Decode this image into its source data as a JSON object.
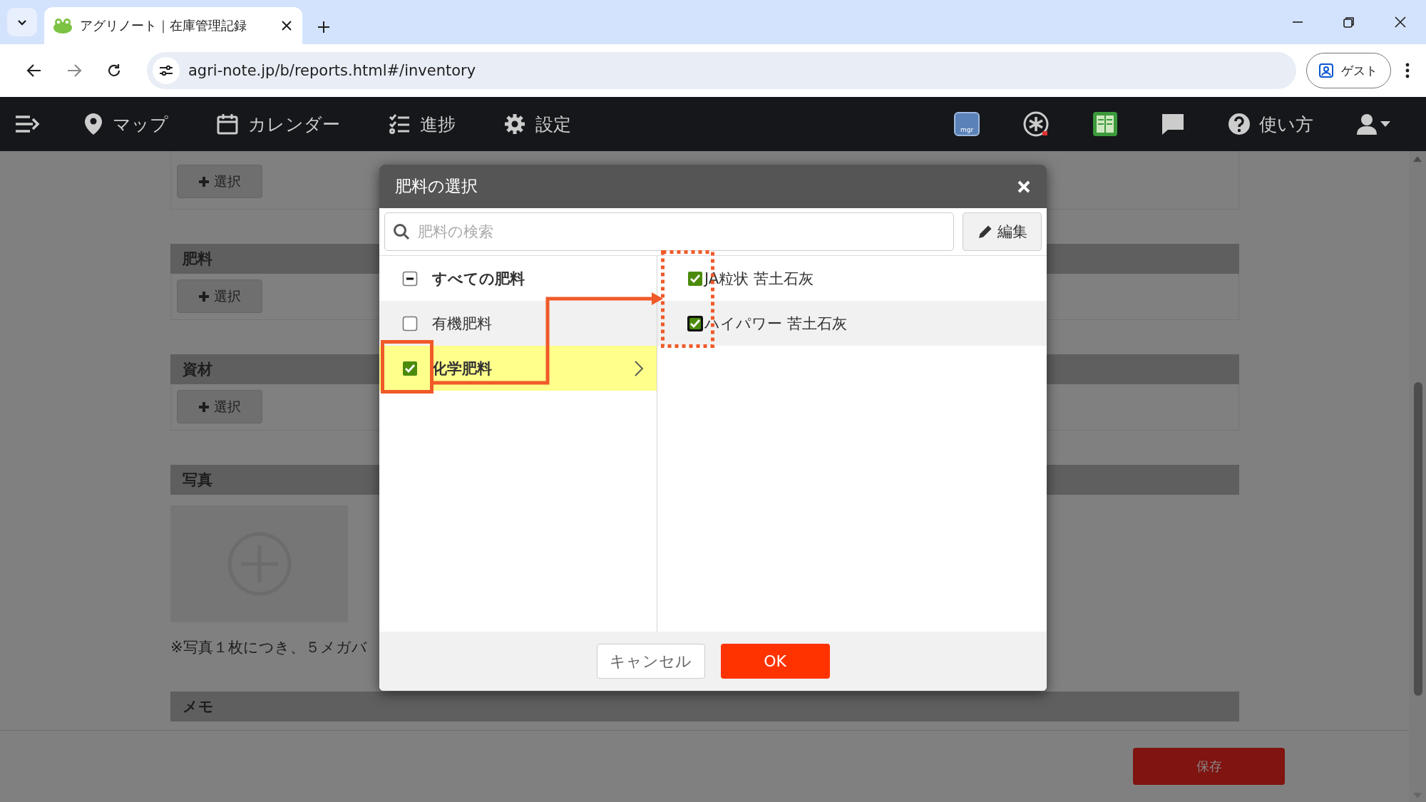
{
  "browser": {
    "tab_title": "アグリノート｜在庫管理記録",
    "url": "agri-note.jp/b/reports.html#/inventory",
    "profile": "ゲスト"
  },
  "nav": {
    "items": [
      {
        "label": "マップ"
      },
      {
        "label": "カレンダー"
      },
      {
        "label": "進捗"
      },
      {
        "label": "設定"
      }
    ],
    "app_badge": "mgr",
    "help": "使い方"
  },
  "page": {
    "top_button": "選択",
    "sections": [
      {
        "kind": "select",
        "title": "肥料",
        "button": "選択"
      },
      {
        "kind": "select",
        "title": "資材",
        "button": "選択"
      },
      {
        "kind": "photo",
        "title": "写真",
        "note": "※写真１枚につき、５メガバ"
      },
      {
        "kind": "memo",
        "title": "メモ"
      }
    ],
    "save_button": "保存"
  },
  "dialog": {
    "title": "肥料の選択",
    "search": {
      "placeholder": "肥料の検索"
    },
    "edit_button": "編集",
    "categories": [
      {
        "kind": "all",
        "label": "すべての肥料",
        "checked": false,
        "indeterminate": true,
        "selected": false,
        "hovered": false
      },
      {
        "kind": "group",
        "label": "有機肥料",
        "checked": false,
        "indeterminate": false,
        "selected": false,
        "hovered": true
      },
      {
        "kind": "group",
        "label": "化学肥料",
        "checked": true,
        "indeterminate": false,
        "selected": true,
        "hovered": false
      }
    ],
    "items": [
      {
        "label": "JA粒状 苦土石灰",
        "checked": true,
        "hovered": false,
        "focused": false
      },
      {
        "label": "ハイパワー 苦土石灰",
        "checked": true,
        "hovered": true,
        "focused": true
      }
    ],
    "cancel_button": "キャンセル",
    "ok_button": "OK"
  }
}
